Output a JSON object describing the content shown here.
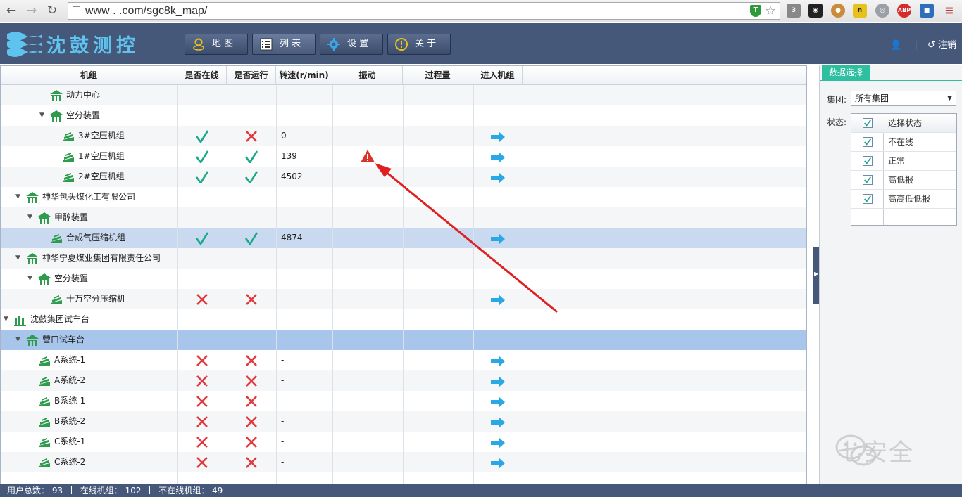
{
  "browser": {
    "url": "www  .  .com/sgc8k_map/",
    "back_icon": "back-arrow-icon",
    "forward_icon": "forward-arrow-icon",
    "reload_icon": "reload-icon",
    "ext_badge": "3",
    "ext_abp": "ABP",
    "ext_n": "n"
  },
  "app": {
    "logo_text": "沈鼓测控",
    "tabs": [
      {
        "label": "地 图",
        "icon": "map-pin-icon"
      },
      {
        "label": "列 表",
        "icon": "list-icon"
      },
      {
        "label": "设 置",
        "icon": "gear-icon"
      },
      {
        "label": "关 于",
        "icon": "info-icon"
      }
    ],
    "logout_label": "注销"
  },
  "grid": {
    "columns": [
      "机组",
      "是否在线",
      "是否运行",
      "转速(r/min)",
      "振动",
      "过程量",
      "进入机组"
    ],
    "rows": [
      {
        "label": "动力中心",
        "level": 3,
        "type": "dept",
        "expander": "",
        "online": null,
        "running": null,
        "speed": "",
        "enter": false
      },
      {
        "label": "空分装置",
        "level": 3,
        "type": "dept",
        "expander": "▼",
        "online": null,
        "running": null,
        "speed": "",
        "enter": false
      },
      {
        "label": "3#空压机组",
        "level": 4,
        "type": "unit",
        "expander": "",
        "online": true,
        "running": false,
        "speed": "0",
        "enter": true
      },
      {
        "label": "1#空压机组",
        "level": 4,
        "type": "unit",
        "expander": "",
        "online": true,
        "running": true,
        "speed": "139",
        "enter": true,
        "vibration_alarm": true
      },
      {
        "label": "2#空压机组",
        "level": 4,
        "type": "unit",
        "expander": "",
        "online": true,
        "running": true,
        "speed": "4502",
        "enter": true
      },
      {
        "label": "神华包头煤化工有限公司",
        "level": 1,
        "type": "dept",
        "expander": "▼",
        "online": null,
        "running": null,
        "speed": "",
        "enter": false
      },
      {
        "label": "甲醇装置",
        "level": 2,
        "type": "dept",
        "expander": "▼",
        "online": null,
        "running": null,
        "speed": "",
        "enter": false
      },
      {
        "label": "合成气压缩机组",
        "level": 3,
        "type": "unit",
        "expander": "",
        "online": true,
        "running": true,
        "speed": "4874",
        "enter": true,
        "selected": true
      },
      {
        "label": "神华宁夏煤业集团有限责任公司",
        "level": 1,
        "type": "dept",
        "expander": "▼",
        "online": null,
        "running": null,
        "speed": "",
        "enter": false
      },
      {
        "label": "空分装置",
        "level": 2,
        "type": "dept",
        "expander": "▼",
        "online": null,
        "running": null,
        "speed": "",
        "enter": false
      },
      {
        "label": "十万空分压缩机",
        "level": 3,
        "type": "unit",
        "expander": "",
        "online": false,
        "running": false,
        "speed": "-",
        "enter": true
      },
      {
        "label": "沈鼓集团试车台",
        "level": 0,
        "type": "group",
        "expander": "▼",
        "online": null,
        "running": null,
        "speed": "",
        "enter": false
      },
      {
        "label": "营口试车台",
        "level": 1,
        "type": "dept",
        "expander": "▼",
        "online": null,
        "running": null,
        "speed": "",
        "enter": false,
        "highlight": true
      },
      {
        "label": "A系统-1",
        "level": 2,
        "type": "unit",
        "expander": "",
        "online": false,
        "running": false,
        "speed": "-",
        "enter": true
      },
      {
        "label": "A系统-2",
        "level": 2,
        "type": "unit",
        "expander": "",
        "online": false,
        "running": false,
        "speed": "-",
        "enter": true
      },
      {
        "label": "B系统-1",
        "level": 2,
        "type": "unit",
        "expander": "",
        "online": false,
        "running": false,
        "speed": "-",
        "enter": true
      },
      {
        "label": "B系统-2",
        "level": 2,
        "type": "unit",
        "expander": "",
        "online": false,
        "running": false,
        "speed": "-",
        "enter": true
      },
      {
        "label": "C系统-1",
        "level": 2,
        "type": "unit",
        "expander": "",
        "online": false,
        "running": false,
        "speed": "-",
        "enter": true
      },
      {
        "label": "C系统-2",
        "level": 2,
        "type": "unit",
        "expander": "",
        "online": false,
        "running": false,
        "speed": "-",
        "enter": true
      }
    ]
  },
  "side_panel": {
    "tab_label": "数据选择",
    "group_label": "集团:",
    "group_value": "所有集团",
    "status_label": "状态:",
    "status_header": "选择状态",
    "status_options": [
      "不在线",
      "正常",
      "高低报",
      "高高低低报"
    ]
  },
  "watermark": "七安全",
  "statusbar": {
    "total_users_label": "用户总数：",
    "total_users": "93",
    "online_label": "在线机组：",
    "online": "102",
    "offline_label": "不在线机组：",
    "offline": "49"
  },
  "colors": {
    "header_bg": "#46587a",
    "accent_teal": "#2ebfa0",
    "check_green": "#1aa78a",
    "cross_red": "#e0393e",
    "enter_blue": "#2aa8e6",
    "annotation_red": "#e02020"
  }
}
